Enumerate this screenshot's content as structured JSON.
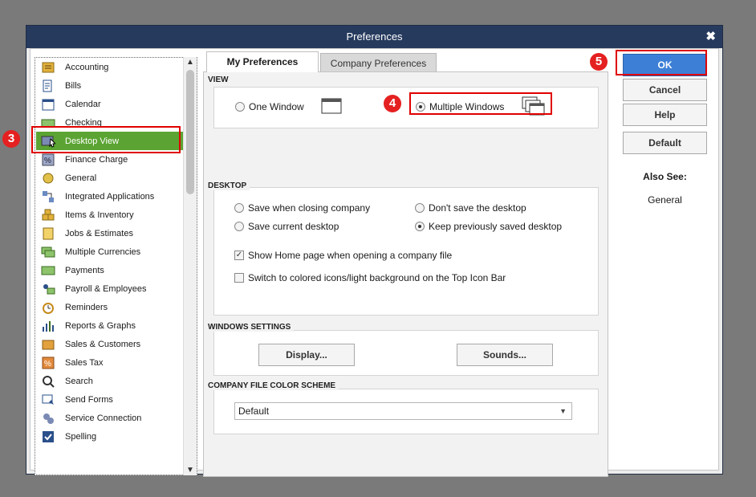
{
  "window": {
    "title": "Preferences",
    "close_glyph": "✖"
  },
  "categories": [
    {
      "label": "Accounting",
      "icon": "accounting-icon"
    },
    {
      "label": "Bills",
      "icon": "bills-icon"
    },
    {
      "label": "Calendar",
      "icon": "calendar-icon"
    },
    {
      "label": "Checking",
      "icon": "checking-icon"
    },
    {
      "label": "Desktop View",
      "icon": "desktop-view-icon",
      "selected": true
    },
    {
      "label": "Finance Charge",
      "icon": "finance-charge-icon"
    },
    {
      "label": "General",
      "icon": "general-icon"
    },
    {
      "label": "Integrated Applications",
      "icon": "integrated-apps-icon"
    },
    {
      "label": "Items & Inventory",
      "icon": "items-inventory-icon"
    },
    {
      "label": "Jobs & Estimates",
      "icon": "jobs-estimates-icon"
    },
    {
      "label": "Multiple Currencies",
      "icon": "multiple-currencies-icon"
    },
    {
      "label": "Payments",
      "icon": "payments-icon"
    },
    {
      "label": "Payroll & Employees",
      "icon": "payroll-icon"
    },
    {
      "label": "Reminders",
      "icon": "reminders-icon"
    },
    {
      "label": "Reports & Graphs",
      "icon": "reports-graphs-icon"
    },
    {
      "label": "Sales & Customers",
      "icon": "sales-customers-icon"
    },
    {
      "label": "Sales Tax",
      "icon": "sales-tax-icon"
    },
    {
      "label": "Search",
      "icon": "search-icon"
    },
    {
      "label": "Send Forms",
      "icon": "send-forms-icon"
    },
    {
      "label": "Service Connection",
      "icon": "service-connection-icon"
    },
    {
      "label": "Spelling",
      "icon": "spelling-icon"
    }
  ],
  "tabs": {
    "my": "My Preferences",
    "company": "Company Preferences"
  },
  "view": {
    "heading": "VIEW",
    "one_window": "One Window",
    "multiple_windows": "Multiple Windows",
    "selected": "multiple_windows"
  },
  "desktop": {
    "heading": "DESKTOP",
    "save_when_closing": "Save when closing company",
    "dont_save": "Don't save the desktop",
    "save_current": "Save current desktop",
    "keep_previous": "Keep previously saved desktop",
    "selected": "keep_previous",
    "show_home": "Show Home page when opening a company file",
    "show_home_checked": true,
    "colored_icons": "Switch to colored icons/light background on the Top Icon Bar",
    "colored_icons_checked": false
  },
  "windows_settings": {
    "heading": "WINDOWS SETTINGS",
    "display": "Display...",
    "sounds": "Sounds..."
  },
  "color_scheme": {
    "heading": "COMPANY FILE COLOR SCHEME",
    "value": "Default"
  },
  "buttons": {
    "ok": "OK",
    "cancel": "Cancel",
    "help": "Help",
    "default": "Default"
  },
  "also_see": {
    "heading": "Also See:",
    "link": "General"
  },
  "annotations": {
    "step3": "3",
    "step4": "4",
    "step5": "5"
  },
  "colors": {
    "selected_item": "#5ba433",
    "titlebar": "#263a5e",
    "ok_button": "#3d7fd6",
    "highlight": "#e00000"
  }
}
